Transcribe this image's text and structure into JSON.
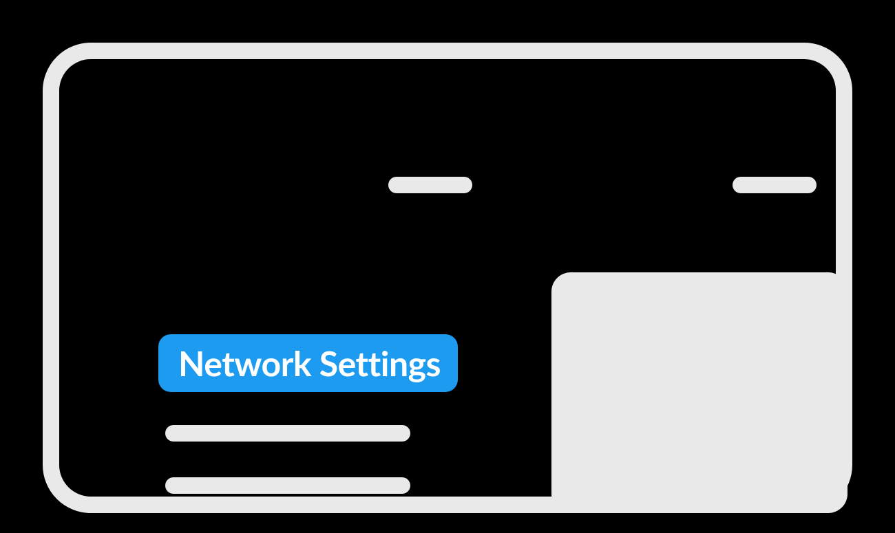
{
  "label": {
    "text": "Network Settings",
    "bg_color": "#1D9BF0",
    "text_color": "#FFFFFF"
  },
  "placeholder_color": "#E9E9E9",
  "background_color": "#000000"
}
